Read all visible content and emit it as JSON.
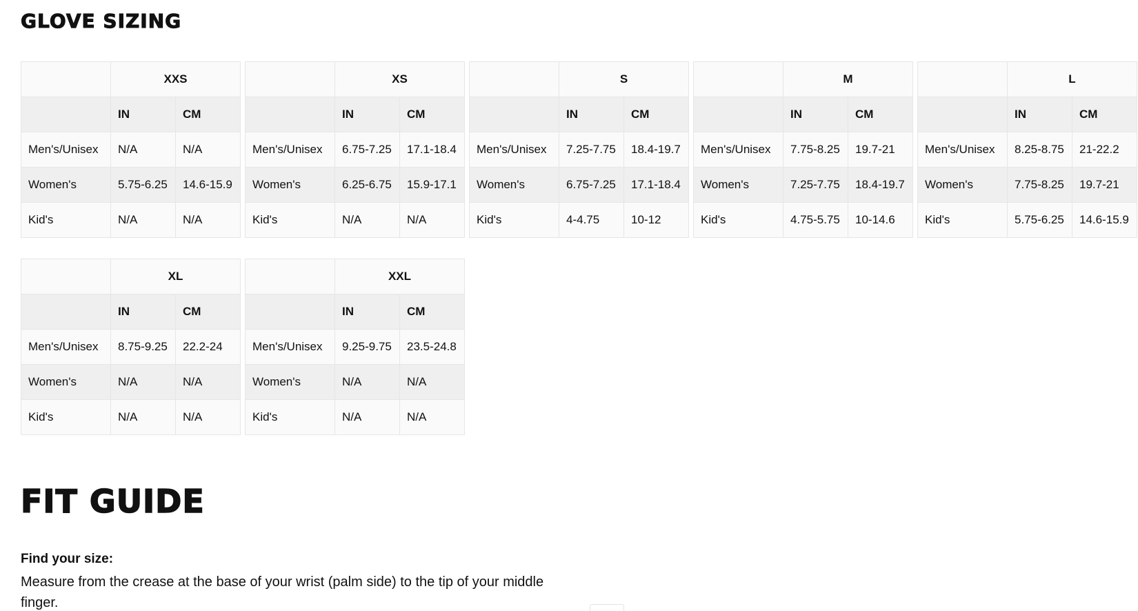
{
  "glove_sizing": {
    "title": "GLOVE SIZING",
    "unit_labels": {
      "in": "IN",
      "cm": "CM"
    },
    "row_labels": [
      "Men's/Unisex",
      "Women's",
      "Kid's"
    ],
    "sizes": [
      {
        "size": "XXS",
        "rows": [
          [
            "N/A",
            "N/A"
          ],
          [
            "5.75-6.25",
            "14.6-15.9"
          ],
          [
            "N/A",
            "N/A"
          ]
        ]
      },
      {
        "size": "XS",
        "rows": [
          [
            "6.75-7.25",
            "17.1-18.4"
          ],
          [
            "6.25-6.75",
            "15.9-17.1"
          ],
          [
            "N/A",
            "N/A"
          ]
        ]
      },
      {
        "size": "S",
        "rows": [
          [
            "7.25-7.75",
            "18.4-19.7"
          ],
          [
            "6.75-7.25",
            "17.1-18.4"
          ],
          [
            "4-4.75",
            "10-12"
          ]
        ]
      },
      {
        "size": "M",
        "rows": [
          [
            "7.75-8.25",
            "19.7-21"
          ],
          [
            "7.25-7.75",
            "18.4-19.7"
          ],
          [
            "4.75-5.75",
            "10-14.6"
          ]
        ]
      },
      {
        "size": "L",
        "rows": [
          [
            "8.25-8.75",
            "21-22.2"
          ],
          [
            "7.75-8.25",
            "19.7-21"
          ],
          [
            "5.75-6.25",
            "14.6-15.9"
          ]
        ]
      },
      {
        "size": "XL",
        "rows": [
          [
            "8.75-9.25",
            "22.2-24"
          ],
          [
            "N/A",
            "N/A"
          ],
          [
            "N/A",
            "N/A"
          ]
        ]
      },
      {
        "size": "XXL",
        "rows": [
          [
            "9.25-9.75",
            "23.5-24.8"
          ],
          [
            "N/A",
            "N/A"
          ],
          [
            "N/A",
            "N/A"
          ]
        ]
      }
    ]
  },
  "fit_guide": {
    "title": "FIT GUIDE",
    "find_label": "Find your size:",
    "instructions": "Measure from the crease at the base of your wrist (palm side) to the tip of your middle finger."
  }
}
